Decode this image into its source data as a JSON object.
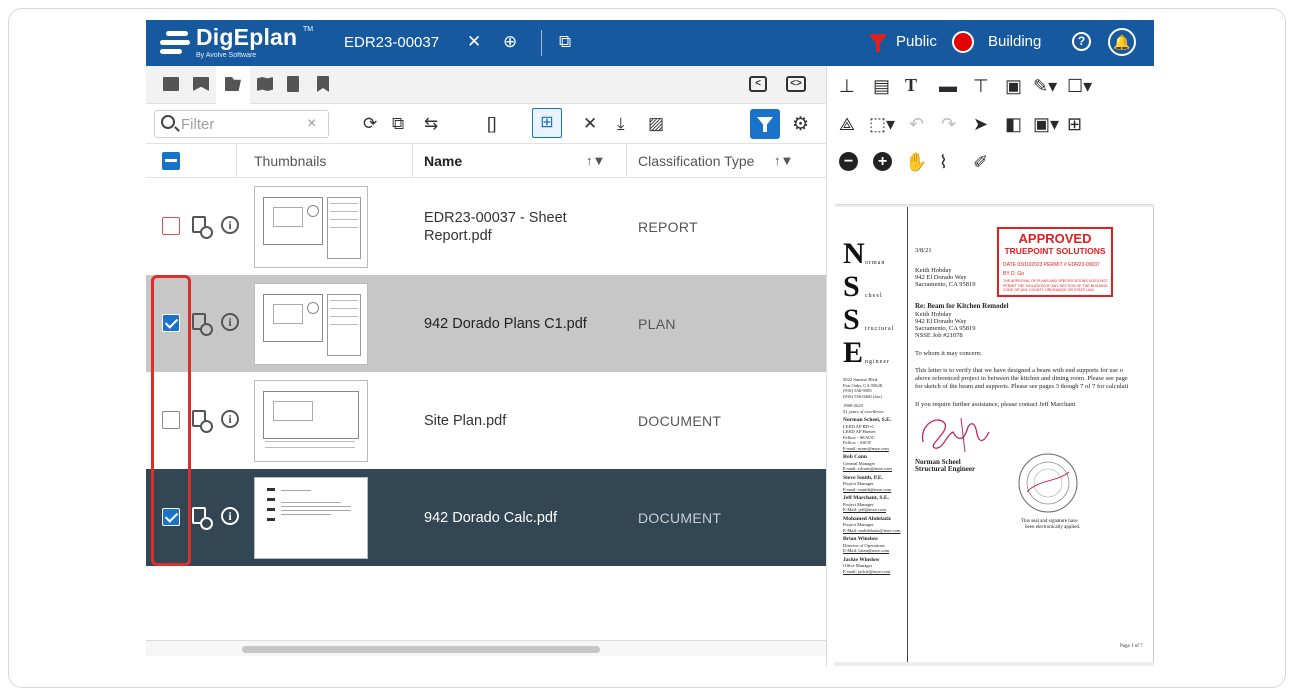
{
  "app": {
    "logo_name": "DigEplan",
    "logo_tm": "TM",
    "logo_by": "By Avolve Software",
    "doc_id": "EDR23-00037",
    "visibility": "Public",
    "discipline": "Building",
    "help_glyph": "?",
    "bell_glyph": "🔔",
    "close_glyph": "✕",
    "add_glyph": "⊕",
    "popout_glyph": "⧉",
    "accent_color": "#16599f",
    "primary_blue": "#1a73c9",
    "status_red": "#e40000"
  },
  "left": {
    "filter_placeholder": "Filter",
    "filter_clear": "×",
    "collapse_left_glyph": "<",
    "collapse_both_glyph": "<>",
    "columns": {
      "thumbnails": "Thumbnails",
      "name": "Name",
      "classification": "Classification Type"
    },
    "sort_glyph": "↑▼",
    "rows": [
      {
        "name": "EDR23-00037 - Sheet Report.pdf",
        "classification": "REPORT",
        "checked": false,
        "style": "white",
        "thumb": "plan"
      },
      {
        "name": "942 Dorado Plans C1.pdf",
        "classification": "PLAN",
        "checked": true,
        "style": "grey",
        "thumb": "plan"
      },
      {
        "name": "Site Plan.pdf",
        "classification": "DOCUMENT",
        "checked": false,
        "style": "white",
        "thumb": "plan"
      },
      {
        "name": "942 Dorado Calc.pdf",
        "classification": "DOCUMENT",
        "checked": true,
        "style": "dark",
        "thumb": "letter"
      }
    ],
    "info_glyph": "i"
  },
  "viewer": {
    "letterhead": [
      {
        "letter": "N",
        "word": "orman"
      },
      {
        "letter": "S",
        "word": "cheel"
      },
      {
        "letter": "S",
        "word": "tructural"
      },
      {
        "letter": "E",
        "word": "ngineer"
      }
    ],
    "date": "3/8/21",
    "address_block": [
      "Keith Hobday",
      "942 El Dorado Way",
      "Sacramento, CA 95819"
    ],
    "re_title": "Re: Beam for Kitchen Remodel",
    "re_block": [
      "Keith Hobday",
      "942 El Dorado Way",
      "Sacramento, CA 95819",
      "NSSE Job #21078"
    ],
    "salutation": "To whom it may concern:",
    "body_lines": [
      "This letter is to verify that we have designed a beam with end supports for use o",
      "above referenced project in between the kitchen and dining room.  Please see page",
      "for sketch of the beam and supports.  Please see pages 3 though 7 of 7 for calculati"
    ],
    "assist_line": "If you require further assistance, please contact Jeff Marchant",
    "sign_name": "Norman Scheel",
    "sign_title": "Structural Engineer",
    "seal_note": [
      "This seal and signature have",
      "been electronically applied."
    ],
    "sidebar": [
      "5022 Sunrise Blvd.",
      "Fair Oaks, CA  95628",
      "(916) 536-9585",
      "(916) 536-0260 (fax)",
      "",
      "1969-2020",
      "51 years of excellence",
      "",
      "Norman Scheel, S.E.",
      "LEED AP BD+C",
      "LEED AP Homes",
      "Fellow - SEAOC",
      "Fellow - ASCE",
      "E-mail: norm@nsse.com",
      "",
      "Rob Conn",
      "General Manager",
      "E-mail: rdconn@nsse.com",
      "",
      "Steve Smith, P.E.",
      "Project Manager",
      "E-mail: ssmith@nsse.com",
      "",
      "Jeff Marchant, S.E.",
      "Project Manager",
      "E-Mail: jeff@nsse.com",
      "",
      "Mohamed Abdelaziz",
      "Project Manager",
      "E-Mail: mabdelaziz@nsse.com",
      "",
      "Brian Winslow",
      "Director of Operations",
      "E-Mail: brian@nsse.com",
      "",
      "Jackie Winslow",
      "Office Manager",
      "E-mail: jackie@nsse.com"
    ],
    "stamp": {
      "title": "APPROVED",
      "subtitle": "TRUEPOINT SOLUTIONS",
      "line1": "DATE  03/10/2023   PERMIT #   EDR23-00037",
      "line2": "BY    D. Go",
      "fine": "THE APPROVAL OF PLANS AND SPECIFICATIONS DOES NOT PERMIT THE VIOLATION OF ANY SECTION OF THE BUILDING CODE OR ANY COUNTY ORDINANCE OR STATE LAW."
    },
    "page_label": "Page 1 of 7"
  }
}
